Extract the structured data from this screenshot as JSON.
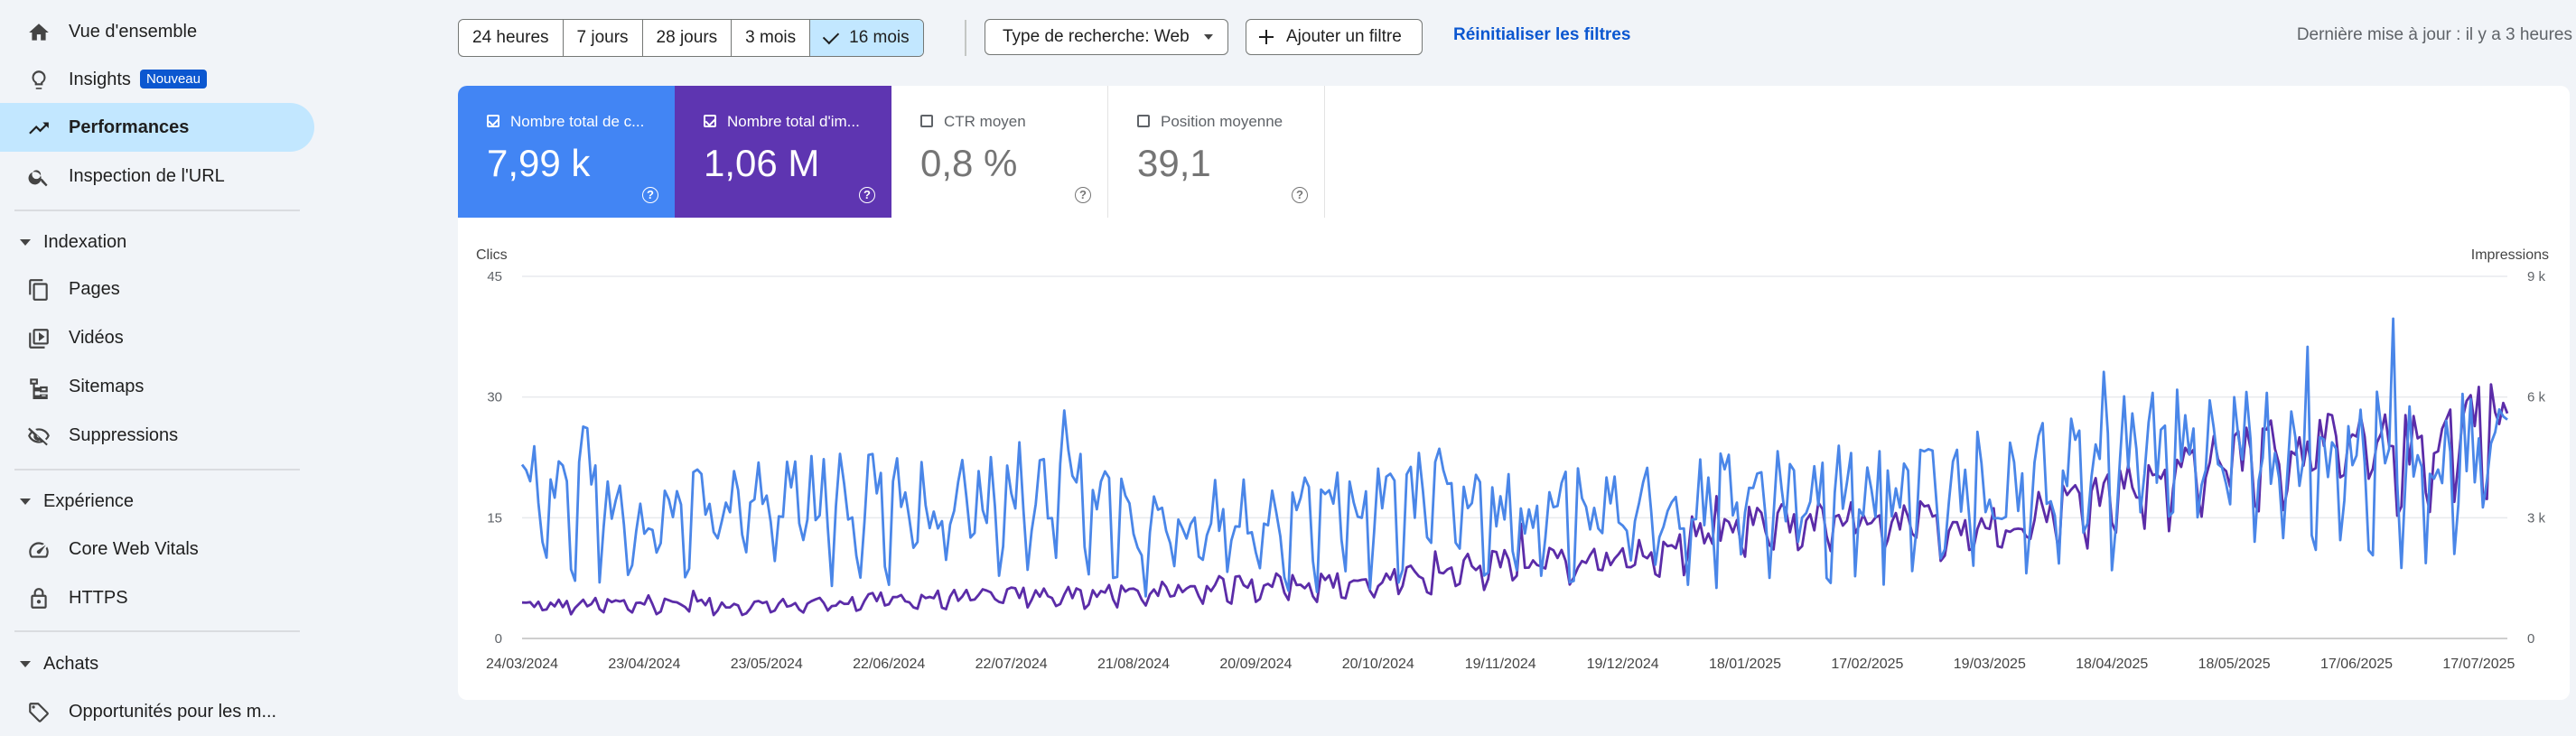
{
  "sidebar": {
    "items": [
      {
        "label": "Vue d'ensemble",
        "icon": "home-icon"
      },
      {
        "label": "Insights",
        "badge": "Nouveau",
        "icon": "lightbulb-icon"
      },
      {
        "label": "Performances",
        "icon": "trending-up-icon",
        "active": true
      },
      {
        "label": "Inspection de l'URL",
        "icon": "search-icon"
      }
    ],
    "sections": [
      {
        "title": "Indexation",
        "items": [
          {
            "label": "Pages",
            "icon": "pages-icon"
          },
          {
            "label": "Vidéos",
            "icon": "video-icon"
          },
          {
            "label": "Sitemaps",
            "icon": "sitemap-icon"
          },
          {
            "label": "Suppressions",
            "icon": "eye-off-icon"
          }
        ]
      },
      {
        "title": "Expérience",
        "items": [
          {
            "label": "Core Web Vitals",
            "icon": "speed-icon"
          },
          {
            "label": "HTTPS",
            "icon": "lock-icon"
          }
        ]
      },
      {
        "title": "Achats",
        "items": [
          {
            "label": "Opportunités pour les m...",
            "icon": "tag-icon"
          }
        ]
      }
    ]
  },
  "toolbar": {
    "ranges": [
      "24 heures",
      "7 jours",
      "28 jours",
      "3 mois",
      "16 mois"
    ],
    "selected_range": "16 mois",
    "search_type": "Type de recherche: Web",
    "add_filter": "Ajouter un filtre",
    "reset": "Réinitialiser les filtres",
    "last_update": "Dernière mise à jour : il y a 3 heures"
  },
  "metrics": [
    {
      "label": "Nombre total de clics",
      "label_display": "Nombre total de c...",
      "value": "7,99 k",
      "checked": true,
      "color": "#4285f4"
    },
    {
      "label": "Nombre total d'impressions",
      "label_display": "Nombre total d'im...",
      "value": "1,06 M",
      "checked": true,
      "color": "#5e35b1"
    },
    {
      "label": "CTR moyen",
      "label_display": "CTR moyen",
      "value": "0,8 %",
      "checked": false
    },
    {
      "label": "Position moyenne",
      "label_display": "Position moyenne",
      "value": "39,1",
      "checked": false
    }
  ],
  "colors": {
    "clicks": "#4a86e8",
    "impressions": "#5b2ca8",
    "accent": "#0b57d0",
    "selected": "#c2e7ff"
  },
  "chart_data": {
    "type": "line",
    "left_axis_title": "Clics",
    "right_axis_title": "Impressions",
    "left_ticks": [
      "0",
      "15",
      "30",
      "45"
    ],
    "right_ticks": [
      "0",
      "3 k",
      "6 k",
      "9 k"
    ],
    "ylim_left": [
      0,
      45
    ],
    "ylim_right": [
      0,
      9000
    ],
    "x_tick_labels": [
      "24/03/2024",
      "23/04/2024",
      "23/05/2024",
      "22/06/2024",
      "22/07/2024",
      "21/08/2024",
      "20/09/2024",
      "20/10/2024",
      "19/11/2024",
      "19/12/2024",
      "18/01/2025",
      "17/02/2025",
      "19/03/2025",
      "18/04/2025",
      "18/05/2025",
      "17/06/2025",
      "17/07/2025"
    ],
    "x_start": "2024-03-24",
    "x_end": "2025-07-24",
    "grid": true,
    "series": [
      {
        "name": "Clics",
        "axis": "left",
        "keypoints": [
          [
            "2024-03-24",
            18
          ],
          [
            "2024-04-10",
            16
          ],
          [
            "2024-05-01",
            15
          ],
          [
            "2024-05-23",
            16
          ],
          [
            "2024-06-15",
            17
          ],
          [
            "2024-07-06",
            16
          ],
          [
            "2024-07-22",
            17
          ],
          [
            "2024-08-10",
            18
          ],
          [
            "2024-08-21",
            12
          ],
          [
            "2024-09-05",
            14
          ],
          [
            "2024-09-20",
            15
          ],
          [
            "2024-10-05",
            15
          ],
          [
            "2024-10-20",
            16
          ],
          [
            "2024-11-05",
            17
          ],
          [
            "2024-11-19",
            15
          ],
          [
            "2024-12-05",
            16
          ],
          [
            "2024-12-19",
            16
          ],
          [
            "2025-01-05",
            16
          ],
          [
            "2025-01-18",
            17
          ],
          [
            "2025-02-05",
            17
          ],
          [
            "2025-02-17",
            18
          ],
          [
            "2025-03-05",
            17
          ],
          [
            "2025-03-19",
            17
          ],
          [
            "2025-04-05",
            20
          ],
          [
            "2025-04-18",
            22
          ],
          [
            "2025-05-05",
            23
          ],
          [
            "2025-05-18",
            23
          ],
          [
            "2025-06-05",
            22
          ],
          [
            "2025-06-17",
            22
          ],
          [
            "2025-07-01",
            22
          ],
          [
            "2025-07-17",
            23
          ],
          [
            "2025-07-24",
            22
          ]
        ]
      },
      {
        "name": "Impressions",
        "axis": "right",
        "keypoints": [
          [
            "2024-03-24",
            800
          ],
          [
            "2024-04-23",
            850
          ],
          [
            "2024-05-23",
            800
          ],
          [
            "2024-06-22",
            950
          ],
          [
            "2024-07-22",
            1050
          ],
          [
            "2024-08-21",
            1100
          ],
          [
            "2024-09-20",
            1350
          ],
          [
            "2024-10-20",
            1350
          ],
          [
            "2024-11-19",
            1900
          ],
          [
            "2024-12-19",
            1900
          ],
          [
            "2025-01-18",
            2700
          ],
          [
            "2025-02-17",
            3000
          ],
          [
            "2025-03-19",
            2700
          ],
          [
            "2025-04-18",
            3600
          ],
          [
            "2025-05-18",
            4500
          ],
          [
            "2025-06-17",
            4600
          ],
          [
            "2025-07-05",
            4600
          ],
          [
            "2025-07-15",
            5400
          ],
          [
            "2025-07-24",
            5200
          ]
        ]
      }
    ]
  }
}
